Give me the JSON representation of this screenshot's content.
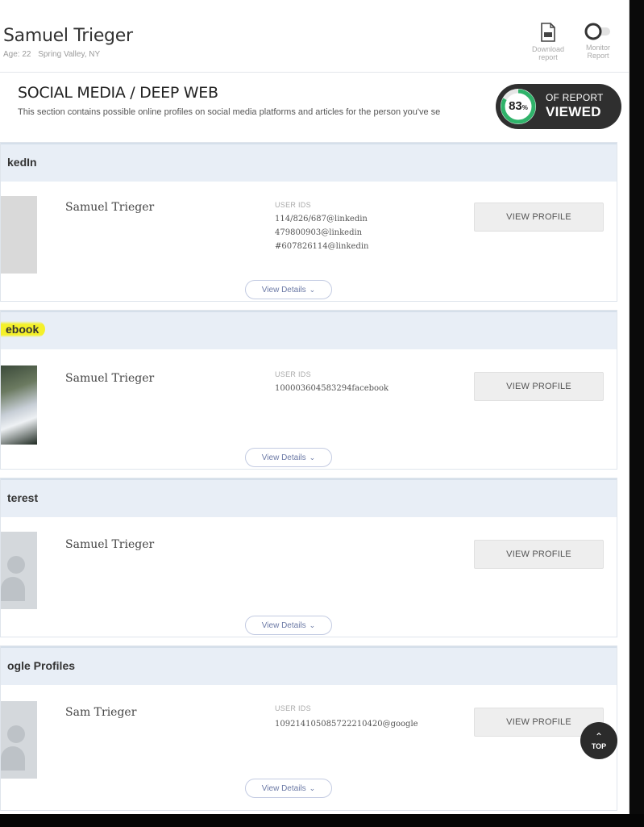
{
  "header": {
    "name": "Samuel Trieger",
    "age": "Age: 22",
    "location": "Spring Valley, NY",
    "download_label_1": "Download",
    "download_label_2": "report",
    "monitor_label_1": "Monitor",
    "monitor_label_2": "Report"
  },
  "section": {
    "title": "SOCIAL MEDIA / DEEP WEB",
    "description": "This section contains possible online profiles on social media platforms and articles for the person you've se"
  },
  "progress": {
    "value": 83,
    "percent_text": "83",
    "percent_sign": "%",
    "label_top": "OF REPORT",
    "label_bottom": "VIEWED",
    "ring_color": "#2fb36a"
  },
  "cards": [
    {
      "title": "kedIn",
      "name": "Samuel Trieger",
      "ids_label": "USER IDS",
      "ids": [
        "114/826/687@linkedin",
        "479800903@linkedin",
        "#607826114@linkedin"
      ],
      "view_label": "VIEW PROFILE",
      "details_label": "View Details",
      "avatar": "placeholder"
    },
    {
      "title": "ebook",
      "name": "Samuel Trieger",
      "ids_label": "USER IDS",
      "ids": [
        "100003604583294facebook"
      ],
      "view_label": "VIEW PROFILE",
      "details_label": "View Details",
      "avatar": "photo"
    },
    {
      "title": "terest",
      "name": "Samuel Trieger",
      "view_label": "VIEW PROFILE",
      "details_label": "View Details",
      "avatar": "ghost"
    },
    {
      "title": "ogle Profiles",
      "name": "Sam Trieger",
      "ids_label": "USER IDS",
      "ids": [
        "109214105085722210420@google"
      ],
      "view_label": "VIEW PROFILE",
      "details_label": "View Details",
      "avatar": "ghost"
    }
  ],
  "scroll_top": {
    "label": "TOP"
  },
  "colors": {
    "card_header_bg": "#e8eef6",
    "highlight": "#f4f02a",
    "pill_bg": "#2f2f2f",
    "details_text": "#6b79a5"
  }
}
